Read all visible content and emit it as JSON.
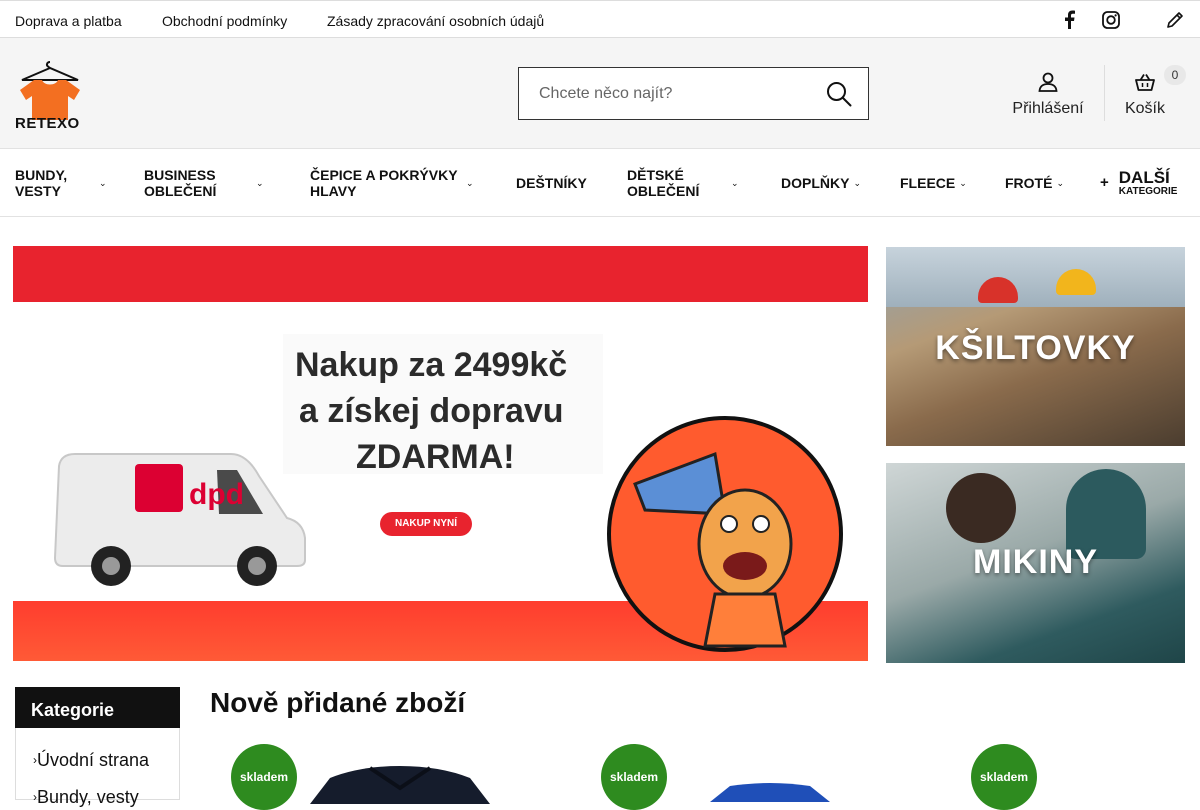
{
  "topbar": {
    "links": [
      "Doprava a platba",
      "Obchodní podmínky",
      "Zásady zpracování osobních údajů"
    ]
  },
  "brand": {
    "name": "RETEXO",
    "color": "#f36f21"
  },
  "search": {
    "placeholder": "Chcete něco najít?"
  },
  "account": {
    "login_label": "Přihlášení",
    "cart_label": "Košík",
    "cart_count": "0"
  },
  "nav": {
    "items": [
      {
        "label": "Bundy, vesty"
      },
      {
        "label": "Business oblečení"
      },
      {
        "label": "Čepice a pokrývky hlavy"
      },
      {
        "label": "Deštníky"
      },
      {
        "label": "Dětské oblečení"
      },
      {
        "label": "Doplňky"
      },
      {
        "label": "Fleece"
      },
      {
        "label": "Froté"
      }
    ],
    "more_label": "Další",
    "more_sub": "kategorie"
  },
  "hero": {
    "headline_1": "Nakup za 2499kč",
    "headline_2": "a získej dopravu",
    "headline_3": "ZDARMA!",
    "cta": "NAKUP NYNÍ",
    "van_brand": "dpd"
  },
  "side_banners": [
    {
      "label": "KŠILTOVKY"
    },
    {
      "label": "MIKINY"
    }
  ],
  "categories": {
    "title": "Kategorie",
    "items": [
      "Úvodní strana",
      "Bundy, vesty"
    ]
  },
  "new_products": {
    "title": "Nově přidané zboží",
    "badge": "skladem"
  },
  "colors": {
    "hero_red": "#e8232e",
    "stock_green": "#2e8b1f"
  }
}
